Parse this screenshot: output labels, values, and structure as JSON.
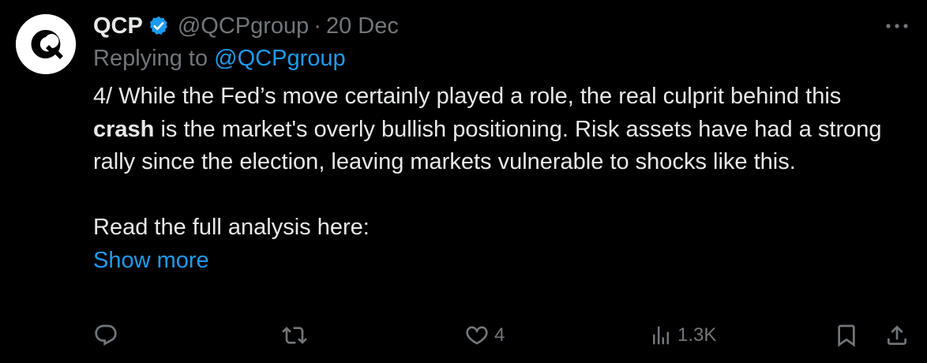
{
  "tweet": {
    "author_name": "QCP",
    "handle": "@QCPgroup",
    "separator": "·",
    "date": "20 Dec",
    "replying_prefix": "Replying to ",
    "replying_to": "@QCPgroup",
    "text_line1": "4/ While the Fed’s move certainly played a role, the real culprit behind this",
    "text_bold": "crash",
    "text_rest": " is the market's overly bullish positioning. Risk assets have had a strong rally since the election, leaving markets vulnerable to shocks like this.",
    "text_read": "Read the full analysis here:",
    "show_more": "Show more",
    "likes": "4",
    "views": "1.3K"
  },
  "icons": {
    "avatar": "qcp-logo",
    "verified": "verified-badge-icon",
    "more": "more-icon",
    "reply": "reply-icon",
    "retweet": "retweet-icon",
    "like": "heart-icon",
    "views": "views-icon",
    "bookmark": "bookmark-icon",
    "share": "share-icon"
  },
  "colors": {
    "background": "#000000",
    "text": "#e7e9ea",
    "secondary": "#71767b",
    "accent": "#1d9bf0"
  }
}
